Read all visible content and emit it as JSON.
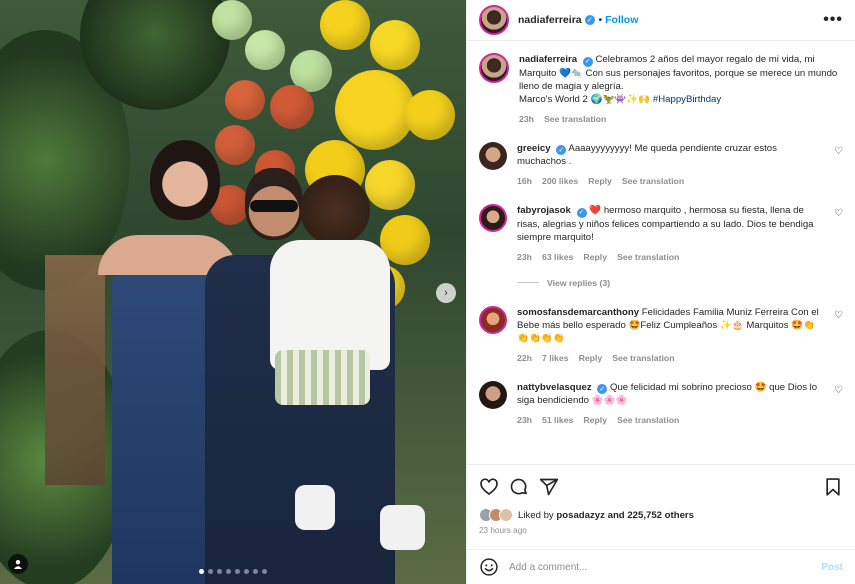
{
  "header": {
    "username": "nadiaferreira",
    "follow_label": "Follow",
    "separator": "•"
  },
  "caption": {
    "username": "nadiaferreira",
    "text": "Celebramos 2 años del mayor regalo de mi vida, mi Marquito 💙🐀 Con sus personajes favoritos, porque se merece un mundo lleno de magia y alegría.",
    "line2": "Marco's World 2 🌍🦖👾✨🙌",
    "hashtag": "#HappyBirthday",
    "time": "23h",
    "see_translation": "See translation"
  },
  "comments": [
    {
      "username": "greeicy",
      "verified": true,
      "text": "Aaaayyyyyyyy! Me queda pendiente cruzar estos muchachos .",
      "time": "16h",
      "likes": "200 likes",
      "reply": "Reply",
      "see_translation": "See translation"
    },
    {
      "username": "fabyrojasok",
      "verified": true,
      "text": "❤️ hermoso marquito , hermosa su fiesta, llena de risas, alegrias y niños felices compartiendo a su lado. Dios te bendiga siempre marquito!",
      "time": "23h",
      "likes": "63 likes",
      "reply": "Reply",
      "see_translation": "See translation",
      "view_replies": "View replies (3)"
    },
    {
      "username": "somosfansdemarcanthony",
      "verified": false,
      "text": "Felicidades Familia Muniz Ferreira Con el Bebe más bello esperado 🤩Feliz Cumpleaños ✨🎂 Marquitos 🤩👏👏👏👏👏",
      "time": "22h",
      "likes": "7 likes",
      "reply": "Reply",
      "see_translation": "See translation"
    },
    {
      "username": "nattybvelasquez",
      "verified": true,
      "text": "Que felicidad mi sobrino precioso 🤩 que Dios lo siga bendiciendo 🌸🌸🌸",
      "time": "23h",
      "likes": "51 likes",
      "reply": "Reply",
      "see_translation": "See translation"
    }
  ],
  "likes": {
    "liked_by_label": "Liked by",
    "liked_by_user": "posadazyz",
    "others": "and 225,752 others",
    "time_ago": "23 hours ago"
  },
  "add_comment": {
    "placeholder": "Add a comment...",
    "post_label": "Post"
  },
  "carousel": {
    "count": 8,
    "active": 1
  },
  "colors": {
    "verified": "#3897f0",
    "follow": "#0095f6",
    "post_disabled": "#b2dffc",
    "hashtag": "#00376b"
  },
  "icons": [
    "heart-icon",
    "comment-icon",
    "share-icon",
    "bookmark-icon",
    "more-icon",
    "emoji-icon",
    "user-tag-icon",
    "chevron-right-icon"
  ]
}
